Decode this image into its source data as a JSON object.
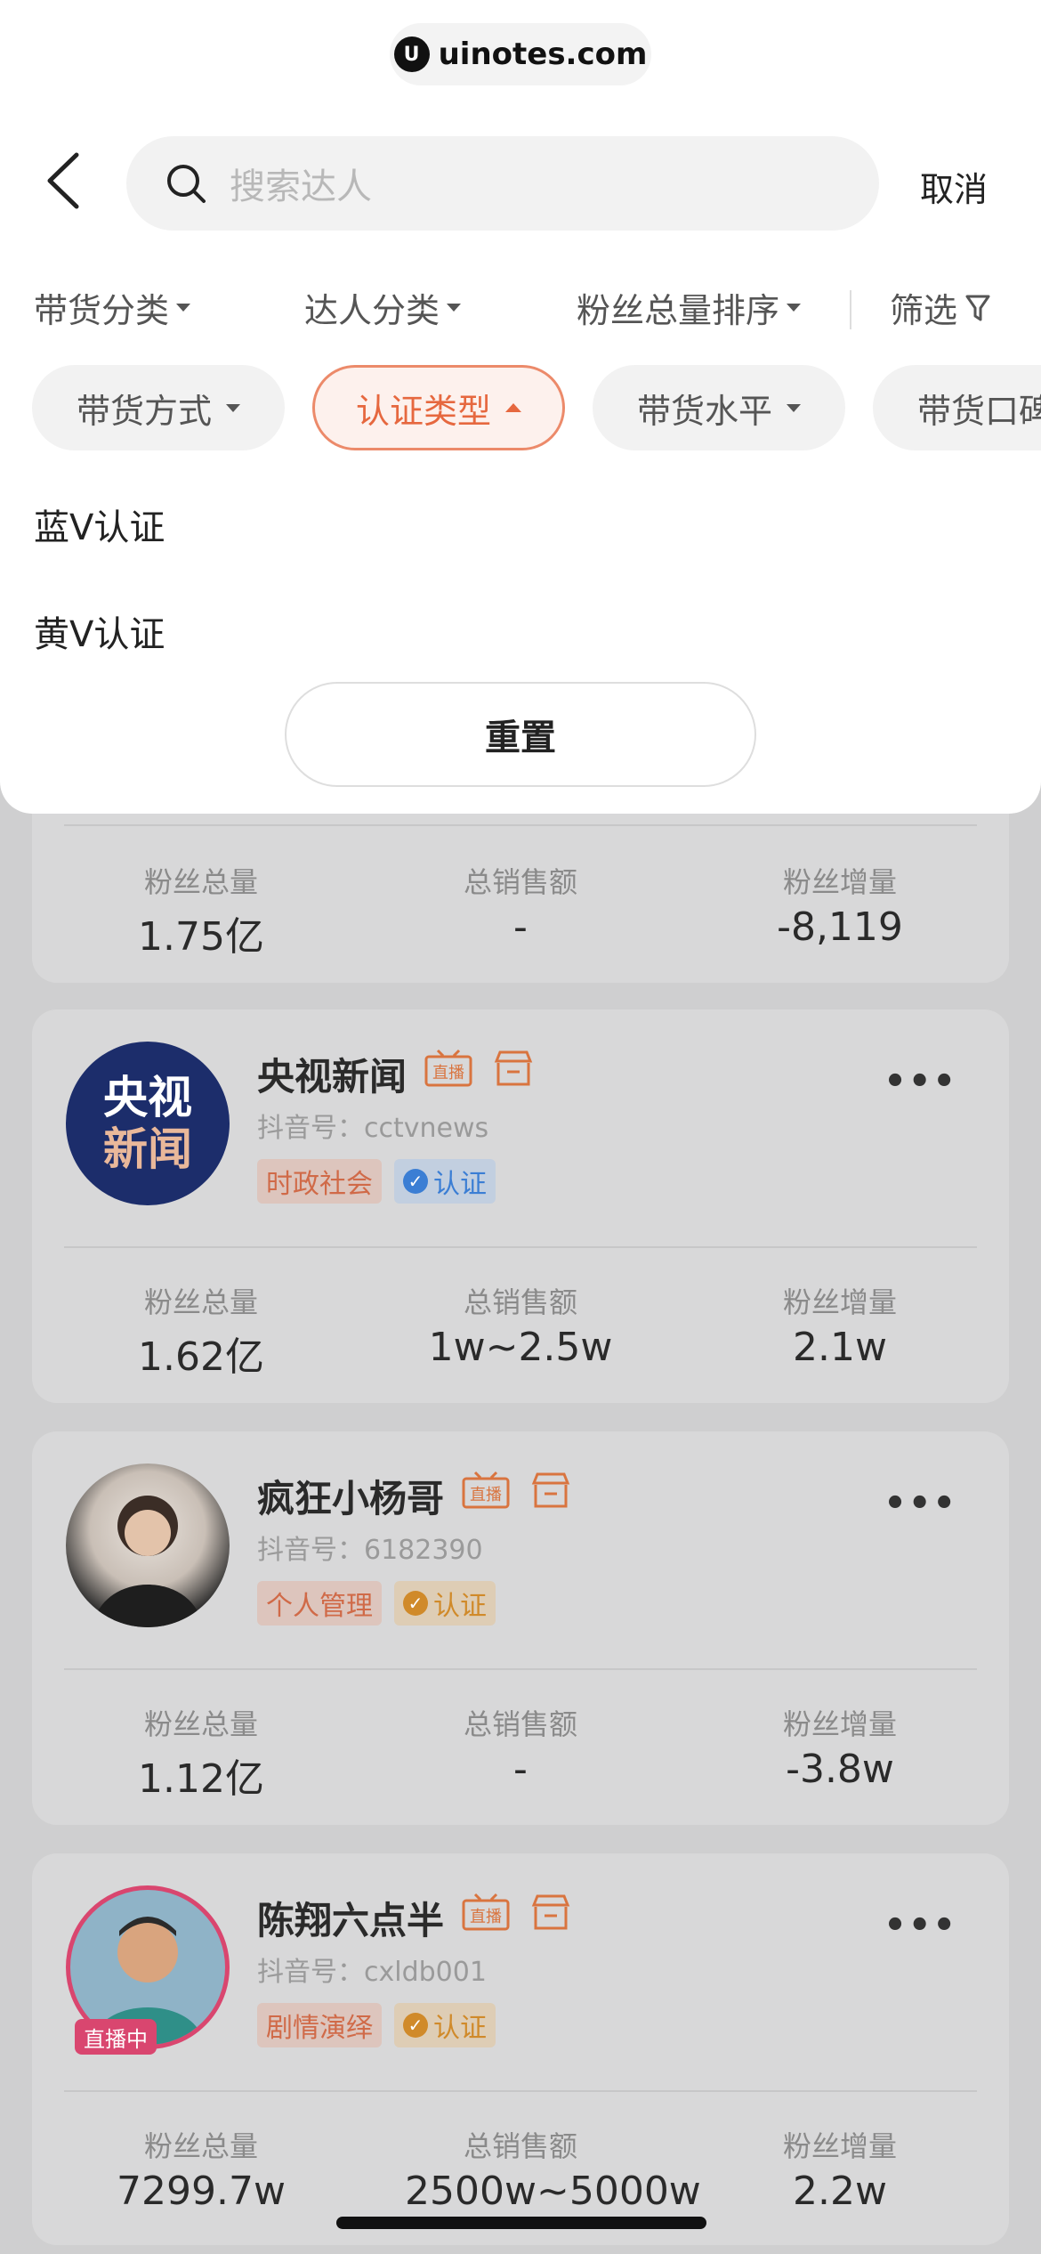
{
  "watermark": {
    "logo": "U",
    "text": "uinotes.com"
  },
  "search": {
    "placeholder": "搜索达人",
    "cancel": "取消"
  },
  "sort_bar": [
    {
      "label": "带货分类"
    },
    {
      "label": "达人分类"
    },
    {
      "label": "粉丝总量排序"
    },
    {
      "label": "筛选"
    }
  ],
  "chips": [
    {
      "label": "带货方式",
      "active": false
    },
    {
      "label": "认证类型",
      "active": true
    },
    {
      "label": "带货水平",
      "active": false
    },
    {
      "label": "带货口碑",
      "active": false
    }
  ],
  "dropdown": {
    "options": [
      "蓝V认证",
      "黄V认证"
    ],
    "reset": "重置"
  },
  "stat_labels": {
    "fans": "粉丝总量",
    "sales": "总销售额",
    "growth": "粉丝增量"
  },
  "partial_card": {
    "fans": "1.75亿",
    "sales": "-",
    "growth": "-8,119"
  },
  "cards": [
    {
      "name": "央视新闻",
      "douyin_label": "抖音号：",
      "douyin_id": "cctvnews",
      "category": "时政社会",
      "verify": "认证",
      "verify_color": "#3b7ed4",
      "fans": "1.62亿",
      "sales": "1w~2.5w",
      "growth": "2.1w",
      "avatar_text_1": "央视",
      "avatar_text_2": "新闻"
    },
    {
      "name": "疯狂小杨哥",
      "douyin_label": "抖音号：",
      "douyin_id": "6182390",
      "category": "个人管理",
      "verify": "认证",
      "verify_color": "#d08a2a",
      "fans": "1.12亿",
      "sales": "-",
      "growth": "-3.8w"
    },
    {
      "name": "陈翔六点半",
      "douyin_label": "抖音号：",
      "douyin_id": "cxldb001",
      "category": "剧情演绎",
      "verify": "认证",
      "verify_color": "#d08a2a",
      "fans": "7299.7w",
      "sales": "2500w~5000w",
      "growth": "2.2w",
      "live": "直播中"
    }
  ],
  "badge_live_text": "直播",
  "colors": {
    "accent": "#e6683f",
    "blue_verify": "#3b7ed4",
    "gold_verify": "#d08a2a",
    "live": "#d9466f"
  }
}
